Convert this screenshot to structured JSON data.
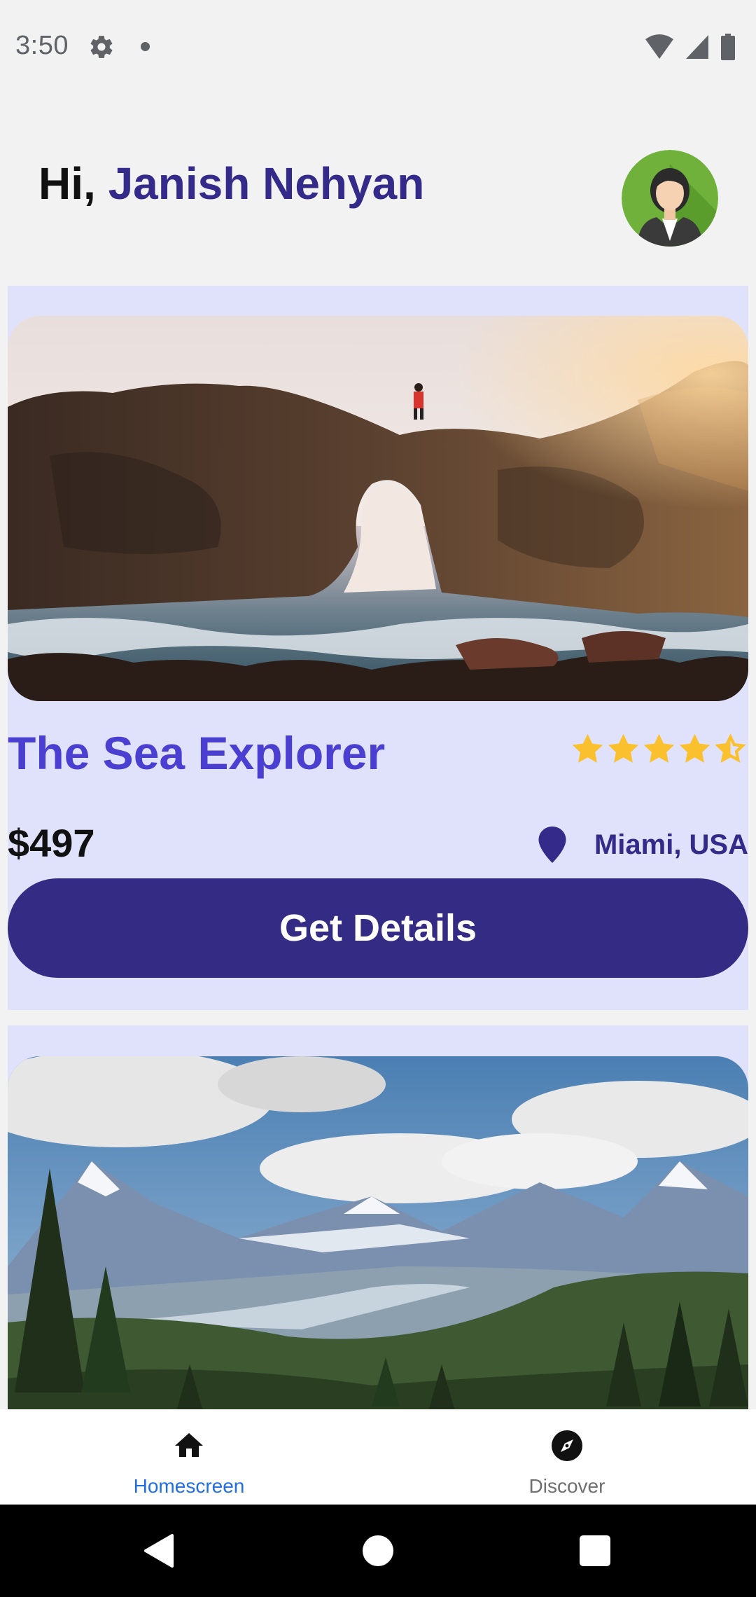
{
  "status_bar": {
    "time": "3:50",
    "icons": [
      "settings-icon",
      "notification-dot-icon",
      "wifi-icon",
      "signal-icon",
      "battery-icon"
    ]
  },
  "header": {
    "greeting": "Hi,",
    "user_name": "Janish Nehyan",
    "avatar_icon": "user-avatar-icon"
  },
  "cards": [
    {
      "image": "sea-arch-photo",
      "title": "The Sea Explorer",
      "rating": 4.5,
      "price": "$497",
      "location": "Miami, USA",
      "button_label": "Get Details"
    },
    {
      "image": "mountain-valley-photo"
    }
  ],
  "bottom_nav": {
    "items": [
      {
        "label": "Homescreen",
        "icon": "home-icon",
        "active": true
      },
      {
        "label": "Discover",
        "icon": "compass-icon",
        "active": false
      }
    ]
  },
  "system_nav": {
    "icons": [
      "back-icon",
      "home-circle-icon",
      "recents-icon"
    ]
  },
  "colors": {
    "accent": "#332a8a",
    "title_purple": "#4a3fd1",
    "card_bg": "#e0e2fc",
    "star": "#fbc02d",
    "nav_active": "#1f6fe0"
  }
}
